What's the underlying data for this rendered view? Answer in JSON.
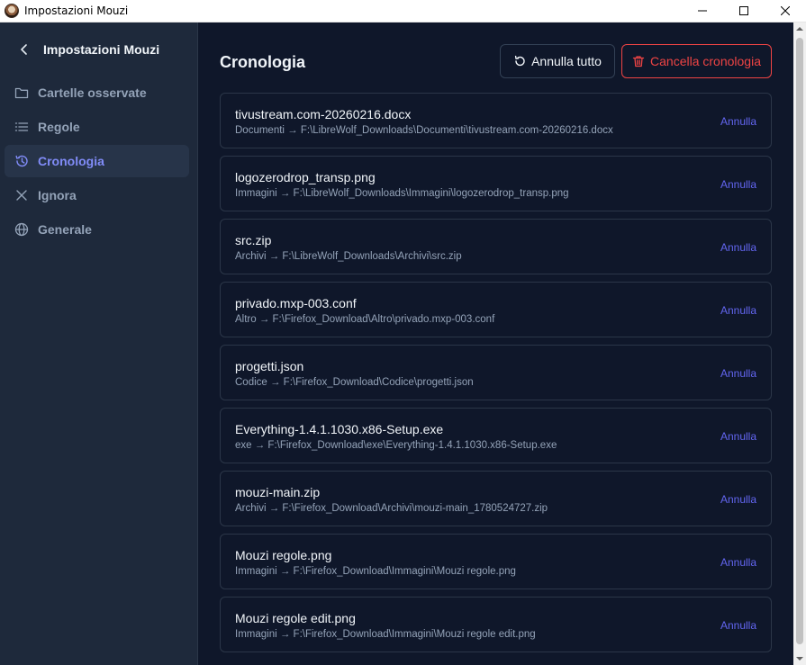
{
  "window": {
    "title": "Impostazioni Mouzi"
  },
  "sidebar": {
    "title": "Impostazioni Mouzi",
    "items": [
      {
        "label": "Cartelle osservate",
        "icon": "folder-icon"
      },
      {
        "label": "Regole",
        "icon": "list-icon"
      },
      {
        "label": "Cronologia",
        "icon": "history-icon",
        "active": true
      },
      {
        "label": "Ignora",
        "icon": "x-icon"
      },
      {
        "label": "Generale",
        "icon": "globe-icon"
      }
    ]
  },
  "main": {
    "title": "Cronologia",
    "undo_all_label": "Annulla tutto",
    "clear_history_label": "Cancella cronologia",
    "entries": [
      {
        "name": "tivustream.com-20260216.docx",
        "path": "Documenti → F:\\LibreWolf_Downloads\\Documenti\\tivustream.com-20260216.docx",
        "action": "Annulla"
      },
      {
        "name": "logozerodrop_transp.png",
        "path": "Immagini → F:\\LibreWolf_Downloads\\Immagini\\logozerodrop_transp.png",
        "action": "Annulla"
      },
      {
        "name": "src.zip",
        "path": "Archivi → F:\\LibreWolf_Downloads\\Archivi\\src.zip",
        "action": "Annulla"
      },
      {
        "name": "privado.mxp-003.conf",
        "path": "Altro → F:\\Firefox_Download\\Altro\\privado.mxp-003.conf",
        "action": "Annulla"
      },
      {
        "name": "progetti.json",
        "path": "Codice → F:\\Firefox_Download\\Codice\\progetti.json",
        "action": "Annulla"
      },
      {
        "name": "Everything-1.4.1.1030.x86-Setup.exe",
        "path": "exe → F:\\Firefox_Download\\exe\\Everything-1.4.1.1030.x86-Setup.exe",
        "action": "Annulla"
      },
      {
        "name": "mouzi-main.zip",
        "path": "Archivi → F:\\Firefox_Download\\Archivi\\mouzi-main_1780524727.zip",
        "action": "Annulla"
      },
      {
        "name": "Mouzi regole.png",
        "path": "Immagini → F:\\Firefox_Download\\Immagini\\Mouzi regole.png",
        "action": "Annulla"
      },
      {
        "name": "Mouzi regole edit.png",
        "path": "Immagini → F:\\Firefox_Download\\Immagini\\Mouzi regole edit.png",
        "action": "Annulla"
      }
    ]
  },
  "colors": {
    "sidebar_bg": "#1e293b",
    "main_bg": "#0f172a",
    "accent": "#818cf8",
    "link": "#6366f1",
    "danger": "#ef4444"
  }
}
